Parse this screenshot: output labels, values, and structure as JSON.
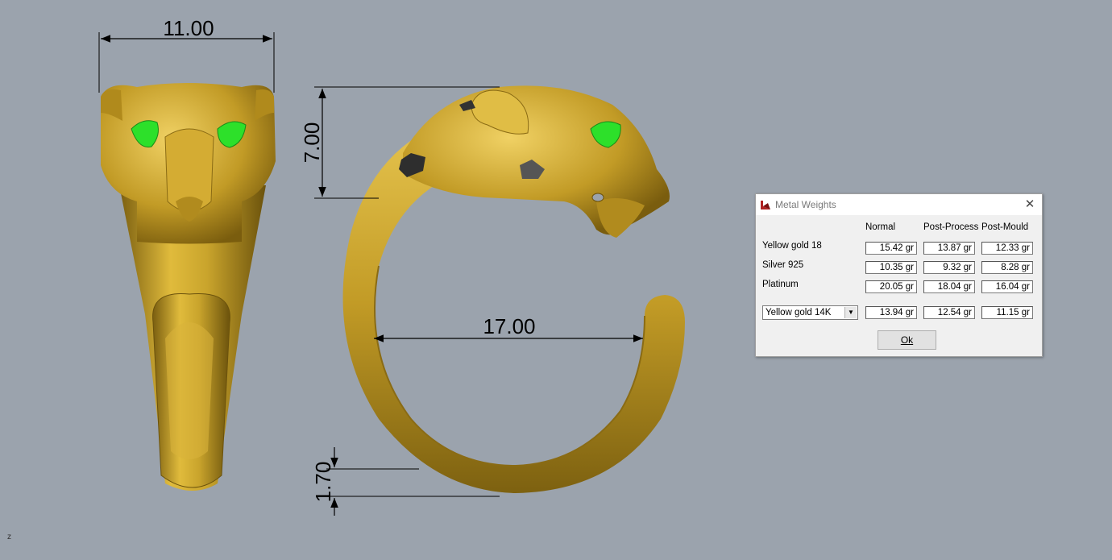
{
  "viewport": {
    "axis_label": "z",
    "dimensions": {
      "front_width": "11.00",
      "head_height": "7.00",
      "inner_diameter": "17.00",
      "band_thickness": "1.70"
    },
    "colors": {
      "background": "#9ba3ad",
      "gold": "#c9a42c",
      "eyes": "#2de02a",
      "spots": "#333333"
    }
  },
  "dialog": {
    "title": "Metal Weights",
    "close_icon": "close-icon",
    "columns": [
      "Normal",
      "Post-Process",
      "Post-Mould"
    ],
    "rows": [
      {
        "label": "Yellow gold 18",
        "values": [
          "15.42 gr",
          "13.87 gr",
          "12.33 gr"
        ]
      },
      {
        "label": "Silver 925",
        "values": [
          "10.35 gr",
          "9.32 gr",
          "8.28 gr"
        ]
      },
      {
        "label": "Platinum",
        "values": [
          "20.05 gr",
          "18.04 gr",
          "16.04 gr"
        ]
      }
    ],
    "custom_row": {
      "selected": "Yellow gold 14K",
      "values": [
        "13.94 gr",
        "12.54 gr",
        "11.15 gr"
      ]
    },
    "ok_label": "Ok"
  }
}
